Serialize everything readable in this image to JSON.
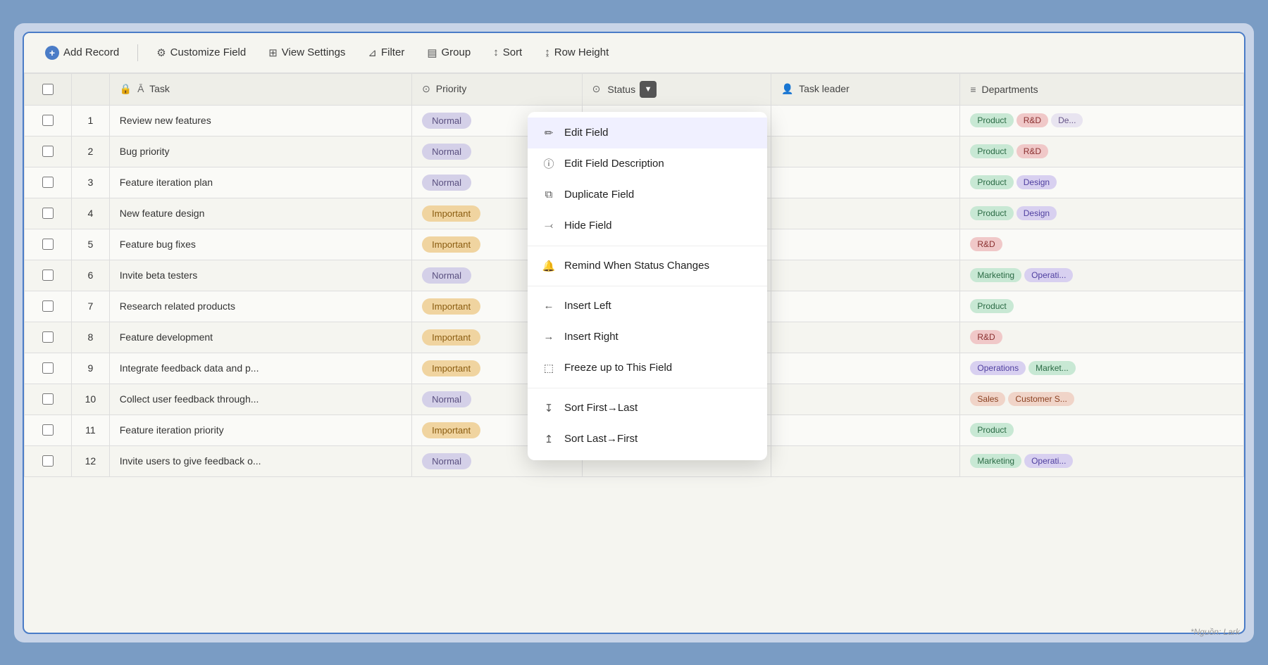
{
  "toolbar": {
    "add_record": "Add Record",
    "customize_field": "Customize Field",
    "view_settings": "View Settings",
    "filter": "Filter",
    "group": "Group",
    "sort": "Sort",
    "row_height": "Row Height"
  },
  "columns": {
    "task": "Task",
    "priority": "Priority",
    "status": "Status",
    "task_leader": "Task leader",
    "departments": "Departments"
  },
  "rows": [
    {
      "id": 1,
      "task": "Review new features",
      "priority": "Normal",
      "depts": [
        {
          "label": "Product",
          "type": "product"
        },
        {
          "label": "R&D",
          "type": "rnd"
        },
        {
          "label": "De...",
          "type": "more"
        }
      ]
    },
    {
      "id": 2,
      "task": "Bug priority",
      "priority": "Normal",
      "depts": [
        {
          "label": "Product",
          "type": "product"
        },
        {
          "label": "R&D",
          "type": "rnd"
        }
      ]
    },
    {
      "id": 3,
      "task": "Feature iteration plan",
      "priority": "Normal",
      "depts": [
        {
          "label": "Product",
          "type": "product"
        },
        {
          "label": "Design",
          "type": "design"
        }
      ]
    },
    {
      "id": 4,
      "task": "New feature design",
      "priority": "Important",
      "depts": [
        {
          "label": "Product",
          "type": "product"
        },
        {
          "label": "Design",
          "type": "design"
        }
      ]
    },
    {
      "id": 5,
      "task": "Feature bug fixes",
      "priority": "Important",
      "depts": [
        {
          "label": "R&D",
          "type": "rnd"
        }
      ]
    },
    {
      "id": 6,
      "task": "Invite beta testers",
      "priority": "Normal",
      "depts": [
        {
          "label": "Marketing",
          "type": "marketing"
        },
        {
          "label": "Operati...",
          "type": "operations"
        }
      ]
    },
    {
      "id": 7,
      "task": "Research related products",
      "priority": "Important",
      "depts": [
        {
          "label": "Product",
          "type": "product"
        }
      ]
    },
    {
      "id": 8,
      "task": "Feature development",
      "priority": "Important",
      "depts": [
        {
          "label": "R&D",
          "type": "rnd"
        }
      ]
    },
    {
      "id": 9,
      "task": "Integrate feedback data and p...",
      "priority": "Important",
      "depts": [
        {
          "label": "Operations",
          "type": "operations"
        },
        {
          "label": "Market...",
          "type": "marketing"
        }
      ]
    },
    {
      "id": 10,
      "task": "Collect user feedback through...",
      "priority": "Normal",
      "depts": [
        {
          "label": "Sales",
          "type": "sales"
        },
        {
          "label": "Customer S...",
          "type": "customer"
        }
      ]
    },
    {
      "id": 11,
      "task": "Feature iteration priority",
      "priority": "Important",
      "depts": [
        {
          "label": "Product",
          "type": "product"
        }
      ]
    },
    {
      "id": 12,
      "task": "Invite users to give feedback o...",
      "priority": "Normal",
      "depts": [
        {
          "label": "Marketing",
          "type": "marketing"
        },
        {
          "label": "Operati...",
          "type": "operations"
        }
      ]
    }
  ],
  "context_menu": {
    "items": [
      {
        "id": "edit-field",
        "label": "Edit Field",
        "icon": "pencil",
        "active": true
      },
      {
        "id": "edit-field-desc",
        "label": "Edit Field Description",
        "icon": "info"
      },
      {
        "id": "duplicate-field",
        "label": "Duplicate Field",
        "icon": "copy"
      },
      {
        "id": "hide-field",
        "label": "Hide Field",
        "icon": "hide"
      },
      {
        "id": "remind-status",
        "label": "Remind When Status Changes",
        "icon": "bell"
      },
      {
        "id": "insert-left",
        "label": "Insert Left",
        "icon": "arrow-left"
      },
      {
        "id": "insert-right",
        "label": "Insert Right",
        "icon": "arrow-right"
      },
      {
        "id": "freeze-field",
        "label": "Freeze up to This Field",
        "icon": "freeze"
      },
      {
        "id": "sort-first-last",
        "label": "Sort First→Last",
        "icon": "sort-az"
      },
      {
        "id": "sort-last-first",
        "label": "Sort Last→First",
        "icon": "sort-za"
      }
    ]
  },
  "watermark": "*Nguồn: Lark"
}
